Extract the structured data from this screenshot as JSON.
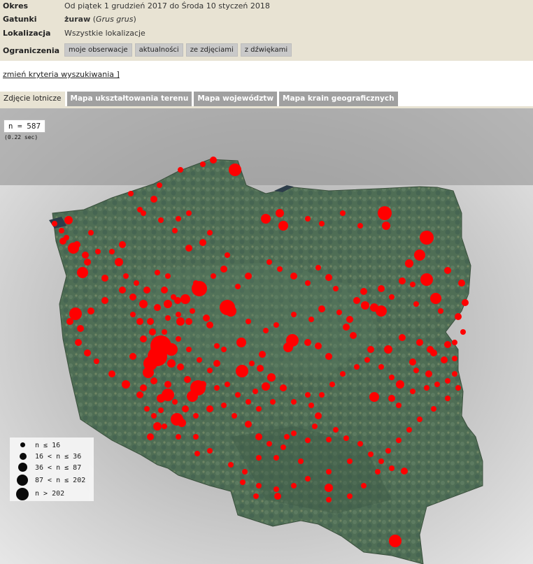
{
  "filters": {
    "period": {
      "label": "Okres",
      "value": "Od piątek 1 grudzień 2017 do Środa 10 styczeń 2018"
    },
    "species": {
      "label": "Gatunki",
      "common": "żuraw",
      "latin": "Grus grus"
    },
    "location": {
      "label": "Lokalizacja",
      "value": "Wszystkie lokalizacje"
    },
    "restrictions": {
      "label": "Ograniczenia",
      "chips": [
        "moje obserwacje",
        "aktualności",
        "ze zdjęciami",
        "z dźwiękami"
      ]
    }
  },
  "change_criteria": "zmień kryteria wyszukiwania ]",
  "tabs": [
    {
      "label": "Zdjęcie lotnicze",
      "active": true
    },
    {
      "label": "Mapa ukształtowania terenu",
      "active": false
    },
    {
      "label": "Mapa województw",
      "active": false
    },
    {
      "label": "Mapa krain geograficznych",
      "active": false
    }
  ],
  "map": {
    "count": "n = 587",
    "timing": "(0.22 sec)",
    "marker_color": "#ff0000",
    "legend": [
      "n ≤ 16",
      "16 < n ≤ 36",
      "36 < n ≤ 87",
      "87 < n ≤ 202",
      "n > 202"
    ]
  }
}
